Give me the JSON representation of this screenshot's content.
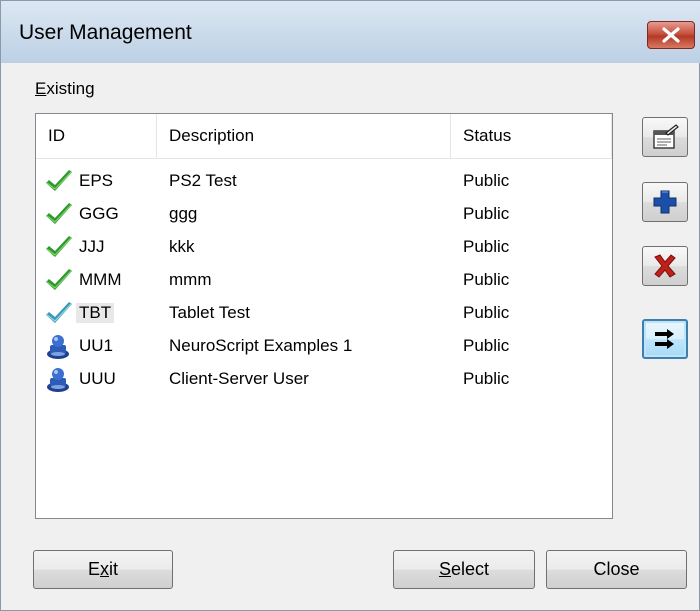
{
  "window": {
    "title": "User Management",
    "close_icon": "close-x-icon"
  },
  "existing_label": {
    "mnemonic": "E",
    "rest": "xisting"
  },
  "columns": {
    "id": "ID",
    "description": "Description",
    "status": "Status"
  },
  "rows": [
    {
      "icon": "green-check-icon",
      "id": "EPS",
      "description": "PS2 Test",
      "status": "Public",
      "selected": false
    },
    {
      "icon": "green-check-icon",
      "id": "GGG",
      "description": "ggg",
      "status": "Public",
      "selected": false
    },
    {
      "icon": "green-check-icon",
      "id": "JJJ",
      "description": "kkk",
      "status": "Public",
      "selected": false
    },
    {
      "icon": "green-check-icon",
      "id": "MMM",
      "description": "mmm",
      "status": "Public",
      "selected": false
    },
    {
      "icon": "teal-check-icon",
      "id": "TBT",
      "description": "Tablet Test",
      "status": "Public",
      "selected": true
    },
    {
      "icon": "user-server-icon",
      "id": "UU1",
      "description": "NeuroScript Examples 1",
      "status": "Public",
      "selected": false
    },
    {
      "icon": "user-server-icon",
      "id": "UUU",
      "description": "Client-Server User",
      "status": "Public",
      "selected": false
    }
  ],
  "side_buttons": {
    "properties_icon": "properties-icon",
    "add_icon": "plus-icon",
    "delete_icon": "red-x-icon",
    "move_icon": "transfer-arrows-icon"
  },
  "buttons": {
    "exit": {
      "pre": "E",
      "mnemonic": "x",
      "post": "it"
    },
    "select": {
      "pre": "",
      "mnemonic": "S",
      "post": "elect"
    },
    "close": {
      "label": "Close"
    }
  },
  "colors": {
    "title_bar": "#c9d9ea",
    "check_green": "#2e9a2e",
    "check_teal": "#3a9bb5",
    "close_red": "#c9503e",
    "add_blue": "#1b4fa8",
    "delete_red": "#c0201a"
  }
}
